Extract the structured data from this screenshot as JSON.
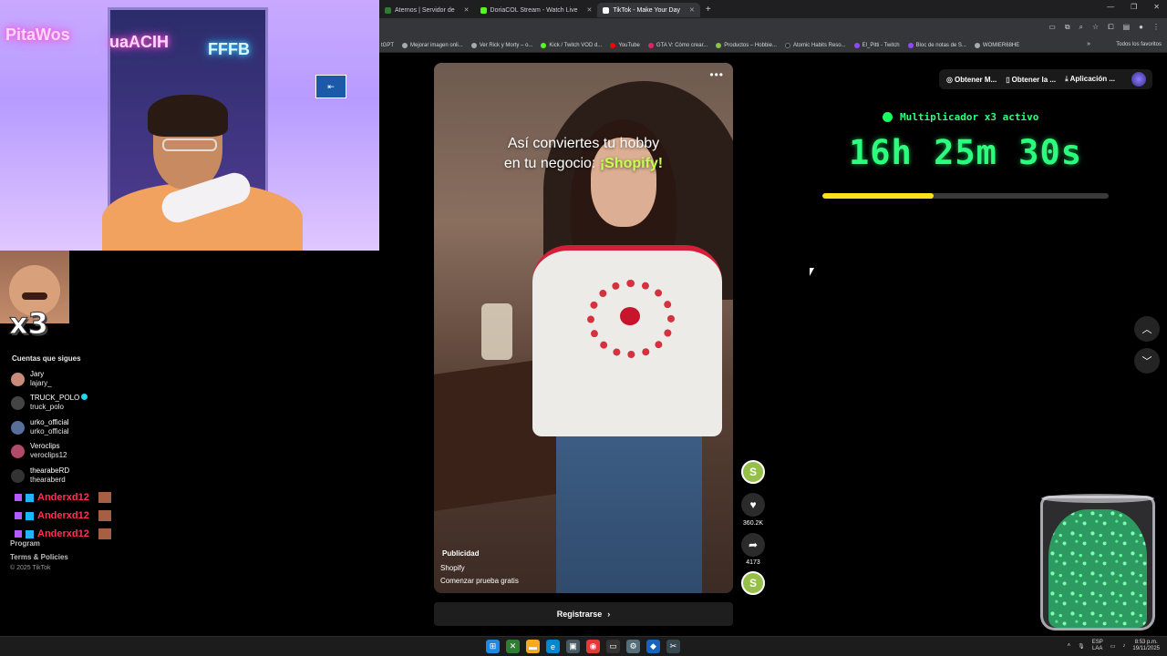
{
  "browser": {
    "tabs": [
      {
        "label": "Aternos | Servidor de",
        "color": "#2e7d32",
        "active": false
      },
      {
        "label": "DoriaCOL Stream - Watch Live",
        "color": "#53fc18",
        "active": false
      },
      {
        "label": "TikTok - Make Your Day",
        "color": "#ffffff",
        "active": true
      }
    ],
    "bookmarks": [
      {
        "label": "tGPT",
        "color": "#888"
      },
      {
        "label": "Mejorar imagen onli...",
        "color": "#aaa"
      },
      {
        "label": "Ver Rick y Morty – o...",
        "color": "#aaa"
      },
      {
        "label": "Kick / Twitch VOD d...",
        "color": "#53fc18"
      },
      {
        "label": "YouTube",
        "color": "#ff0000"
      },
      {
        "label": "GTA V: Cómo crear...",
        "color": "#e91e63"
      },
      {
        "label": "Productos – Hobbie...",
        "color": "#8bc34a"
      },
      {
        "label": "Atomic Habits Reso...",
        "color": "#222"
      },
      {
        "label": "El_Pitti - Twitch",
        "color": "#9146ff"
      },
      {
        "label": "Bloc de notas de S...",
        "color": "#9146ff"
      },
      {
        "label": "WOMIER68HE",
        "color": "#aaa"
      }
    ],
    "all_bookmarks": "Todos los favoritos"
  },
  "overlay": {
    "neon_left": "PitaWos",
    "neon_mid": "uaACIH",
    "neon_right": "FFFB",
    "multiplier_badge": "x3"
  },
  "sidebar": {
    "following_title": "Cuentas que sigues",
    "accounts": [
      {
        "nickname": "Jary",
        "handle": "lajary_",
        "verified": false
      },
      {
        "nickname": "TRUCK_POLO",
        "handle": "truck_polo",
        "verified": true
      },
      {
        "nickname": "urko_official",
        "handle": "urko_official",
        "verified": false
      },
      {
        "nickname": "Veroclips",
        "handle": "veroclips12",
        "verified": false
      },
      {
        "nickname": "thearabeRD",
        "handle": "thearaberd",
        "verified": false
      }
    ],
    "chat_lines": [
      {
        "user": "Anderxd12"
      },
      {
        "user": "Anderxd12"
      },
      {
        "user": "Anderxd12"
      }
    ],
    "footer_program": "Program",
    "footer_terms": "Terms & Policies",
    "copyright": "© 2025 TikTok"
  },
  "video": {
    "caption_line1": "Así conviertes tu hobby",
    "caption_line2_pre": "en tu negocio: ",
    "caption_highlight": "¡Shopify!",
    "more": "•••",
    "ad_label": "Publicidad",
    "ad_brand": "Shopify",
    "ad_cta": "Comenzar prueba gratis",
    "likes": "360.2K",
    "shares": "4173",
    "brand_icon_letter": "S",
    "register_label": "Registrarse",
    "register_chevron": "›"
  },
  "top_controls": {
    "get_coins": "Obtener M...",
    "get_app": "Obtener la ...",
    "app": "Aplicación ..."
  },
  "multiplier": {
    "label": "Multiplicador x3 activo",
    "timer": "16h 25m 30s",
    "progress": 0.39,
    "progress_color": "#ffe11a"
  },
  "taskbar": {
    "lang_top": "ESP",
    "lang_bottom": "LAA",
    "time": "8:53 p.m.",
    "date": "19/11/2025"
  }
}
